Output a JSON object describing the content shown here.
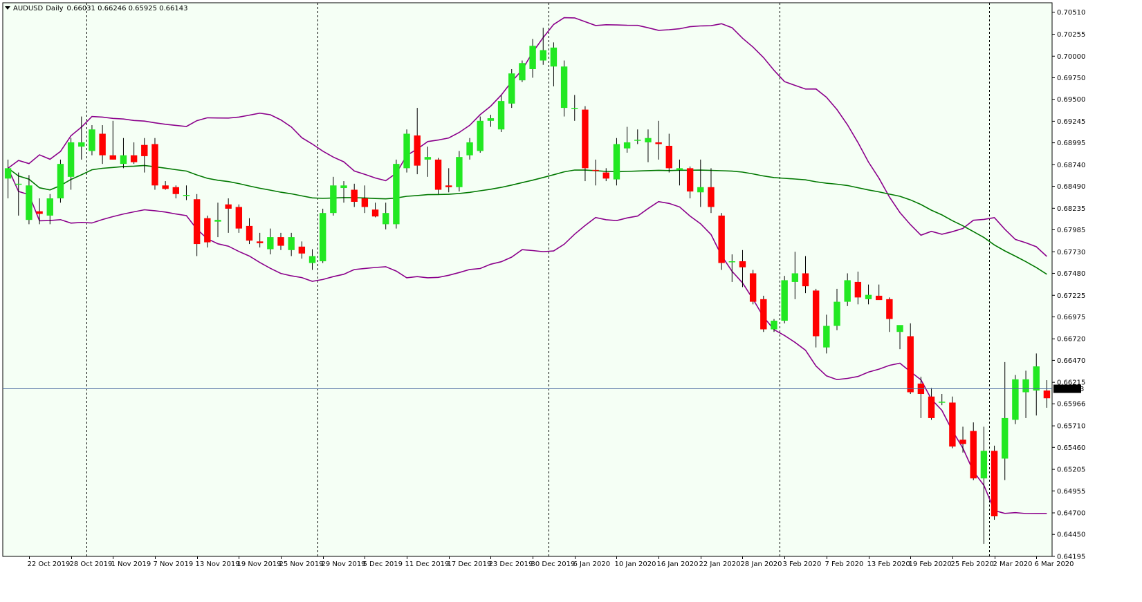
{
  "header": {
    "symbol": "AUDUSD",
    "timeframe": "Daily",
    "ohlc_text": "0.66031 0.66246 0.65925 0.66143"
  },
  "colors": {
    "background": "#f5fff5",
    "bull": "#22e822",
    "bear": "#ff0000",
    "wick": "#000000",
    "bb_line": "#8b008b",
    "ma_line": "#007800",
    "grid_separator": "#000000",
    "price_line": "#4a6aa0",
    "price_box": "#000000",
    "price_box_text": "#ffffff"
  },
  "chart_data": {
    "type": "candlestick",
    "symbol": "AUDUSD",
    "timeframe": "Daily",
    "current_price": 0.66143,
    "y_ticks": [
      0.7051,
      0.70255,
      0.7,
      0.6975,
      0.695,
      0.69245,
      0.68995,
      0.6874,
      0.6849,
      0.68235,
      0.67985,
      0.6773,
      0.6748,
      0.67225,
      0.66975,
      0.6672,
      0.6647,
      0.66215,
      0.65966,
      0.6571,
      0.6546,
      0.65205,
      0.64955,
      0.647,
      0.6445,
      0.64195
    ],
    "ylim": [
      0.64195,
      0.7062
    ],
    "x_tick_labels": [
      {
        "index": 2,
        "label": "22 Oct 2019"
      },
      {
        "index": 6,
        "label": "28 Oct 2019"
      },
      {
        "index": 10,
        "label": "1 Nov 2019"
      },
      {
        "index": 14,
        "label": "7 Nov 2019"
      },
      {
        "index": 18,
        "label": "13 Nov 2019"
      },
      {
        "index": 22,
        "label": "19 Nov 2019"
      },
      {
        "index": 26,
        "label": "25 Nov 2019"
      },
      {
        "index": 30,
        "label": "29 Nov 2019"
      },
      {
        "index": 34,
        "label": "5 Dec 2019"
      },
      {
        "index": 38,
        "label": "11 Dec 2019"
      },
      {
        "index": 42,
        "label": "17 Dec 2019"
      },
      {
        "index": 46,
        "label": "23 Dec 2019"
      },
      {
        "index": 50,
        "label": "30 Dec 2019"
      },
      {
        "index": 54,
        "label": "6 Jan 2020"
      },
      {
        "index": 58,
        "label": "10 Jan 2020"
      },
      {
        "index": 62,
        "label": "16 Jan 2020"
      },
      {
        "index": 66,
        "label": "22 Jan 2020"
      },
      {
        "index": 70,
        "label": "28 Jan 2020"
      },
      {
        "index": 74,
        "label": "3 Feb 2020"
      },
      {
        "index": 78,
        "label": "7 Feb 2020"
      },
      {
        "index": 82,
        "label": "13 Feb 2020"
      },
      {
        "index": 86,
        "label": "19 Feb 2020"
      },
      {
        "index": 90,
        "label": "25 Feb 2020"
      },
      {
        "index": 94,
        "label": "2 Mar 2020"
      },
      {
        "index": 98,
        "label": "6 Mar 2020"
      }
    ],
    "period_separators_at_index": [
      7.5,
      29.5,
      51.5,
      73.5,
      93.5
    ],
    "candles": [
      {
        "o": 0.6858,
        "h": 0.688,
        "l": 0.6835,
        "c": 0.687
      },
      {
        "o": 0.6852,
        "h": 0.6865,
        "l": 0.6815,
        "c": 0.6852
      },
      {
        "o": 0.681,
        "h": 0.6862,
        "l": 0.6805,
        "c": 0.685
      },
      {
        "o": 0.682,
        "h": 0.6835,
        "l": 0.6805,
        "c": 0.6817
      },
      {
        "o": 0.6815,
        "h": 0.684,
        "l": 0.6805,
        "c": 0.6835
      },
      {
        "o": 0.6835,
        "h": 0.688,
        "l": 0.683,
        "c": 0.6875
      },
      {
        "o": 0.686,
        "h": 0.6905,
        "l": 0.6845,
        "c": 0.69
      },
      {
        "o": 0.6895,
        "h": 0.693,
        "l": 0.688,
        "c": 0.69
      },
      {
        "o": 0.689,
        "h": 0.692,
        "l": 0.6885,
        "c": 0.6915
      },
      {
        "o": 0.691,
        "h": 0.692,
        "l": 0.6875,
        "c": 0.6885
      },
      {
        "o": 0.6885,
        "h": 0.6925,
        "l": 0.688,
        "c": 0.688
      },
      {
        "o": 0.6875,
        "h": 0.6905,
        "l": 0.687,
        "c": 0.6885
      },
      {
        "o": 0.6885,
        "h": 0.69,
        "l": 0.6875,
        "c": 0.6877
      },
      {
        "o": 0.6897,
        "h": 0.6905,
        "l": 0.6865,
        "c": 0.6884
      },
      {
        "o": 0.6898,
        "h": 0.6905,
        "l": 0.6845,
        "c": 0.685
      },
      {
        "o": 0.685,
        "h": 0.6855,
        "l": 0.6845,
        "c": 0.6846
      },
      {
        "o": 0.6848,
        "h": 0.685,
        "l": 0.6835,
        "c": 0.684
      },
      {
        "o": 0.6838,
        "h": 0.685,
        "l": 0.6833,
        "c": 0.6839
      },
      {
        "o": 0.6834,
        "h": 0.684,
        "l": 0.6768,
        "c": 0.6782
      },
      {
        "o": 0.6812,
        "h": 0.6815,
        "l": 0.6778,
        "c": 0.6784
      },
      {
        "o": 0.6808,
        "h": 0.683,
        "l": 0.679,
        "c": 0.681
      },
      {
        "o": 0.6828,
        "h": 0.6835,
        "l": 0.6795,
        "c": 0.6823
      },
      {
        "o": 0.6825,
        "h": 0.6828,
        "l": 0.6795,
        "c": 0.68
      },
      {
        "o": 0.6803,
        "h": 0.6812,
        "l": 0.6782,
        "c": 0.6786
      },
      {
        "o": 0.6785,
        "h": 0.6795,
        "l": 0.6778,
        "c": 0.6783
      },
      {
        "o": 0.6776,
        "h": 0.68,
        "l": 0.677,
        "c": 0.679
      },
      {
        "o": 0.679,
        "h": 0.6795,
        "l": 0.6775,
        "c": 0.678
      },
      {
        "o": 0.6775,
        "h": 0.6795,
        "l": 0.6768,
        "c": 0.679
      },
      {
        "o": 0.6779,
        "h": 0.6785,
        "l": 0.6765,
        "c": 0.6771
      },
      {
        "o": 0.676,
        "h": 0.6776,
        "l": 0.6752,
        "c": 0.6768
      },
      {
        "o": 0.6762,
        "h": 0.6823,
        "l": 0.676,
        "c": 0.6818
      },
      {
        "o": 0.6818,
        "h": 0.686,
        "l": 0.6815,
        "c": 0.685
      },
      {
        "o": 0.6847,
        "h": 0.6855,
        "l": 0.683,
        "c": 0.685
      },
      {
        "o": 0.6845,
        "h": 0.6852,
        "l": 0.6825,
        "c": 0.6831
      },
      {
        "o": 0.6835,
        "h": 0.685,
        "l": 0.6818,
        "c": 0.6825
      },
      {
        "o": 0.6822,
        "h": 0.683,
        "l": 0.6813,
        "c": 0.6814
      },
      {
        "o": 0.6805,
        "h": 0.683,
        "l": 0.6799,
        "c": 0.6818
      },
      {
        "o": 0.6805,
        "h": 0.688,
        "l": 0.68,
        "c": 0.6875
      },
      {
        "o": 0.687,
        "h": 0.6915,
        "l": 0.6865,
        "c": 0.691
      },
      {
        "o": 0.6908,
        "h": 0.694,
        "l": 0.6863,
        "c": 0.6873
      },
      {
        "o": 0.688,
        "h": 0.6895,
        "l": 0.686,
        "c": 0.6883
      },
      {
        "o": 0.688,
        "h": 0.6882,
        "l": 0.684,
        "c": 0.6845
      },
      {
        "o": 0.685,
        "h": 0.687,
        "l": 0.6842,
        "c": 0.6848
      },
      {
        "o": 0.6848,
        "h": 0.689,
        "l": 0.6843,
        "c": 0.6883
      },
      {
        "o": 0.6885,
        "h": 0.6905,
        "l": 0.688,
        "c": 0.69
      },
      {
        "o": 0.689,
        "h": 0.693,
        "l": 0.6888,
        "c": 0.6925
      },
      {
        "o": 0.6925,
        "h": 0.6932,
        "l": 0.6918,
        "c": 0.6928
      },
      {
        "o": 0.6915,
        "h": 0.6955,
        "l": 0.6912,
        "c": 0.6948
      },
      {
        "o": 0.6945,
        "h": 0.6985,
        "l": 0.694,
        "c": 0.698
      },
      {
        "o": 0.6972,
        "h": 0.6995,
        "l": 0.697,
        "c": 0.6992
      },
      {
        "o": 0.6985,
        "h": 0.702,
        "l": 0.6975,
        "c": 0.7012
      },
      {
        "o": 0.6995,
        "h": 0.7033,
        "l": 0.699,
        "c": 0.7007
      },
      {
        "o": 0.6988,
        "h": 0.7016,
        "l": 0.6965,
        "c": 0.701
      },
      {
        "o": 0.694,
        "h": 0.6995,
        "l": 0.693,
        "c": 0.6988
      },
      {
        "o": 0.694,
        "h": 0.6955,
        "l": 0.6925,
        "c": 0.694
      },
      {
        "o": 0.6938,
        "h": 0.6942,
        "l": 0.6855,
        "c": 0.687
      },
      {
        "o": 0.6868,
        "h": 0.688,
        "l": 0.685,
        "c": 0.6867
      },
      {
        "o": 0.6865,
        "h": 0.687,
        "l": 0.6855,
        "c": 0.6858
      },
      {
        "o": 0.6857,
        "h": 0.6905,
        "l": 0.685,
        "c": 0.6898
      },
      {
        "o": 0.6893,
        "h": 0.6918,
        "l": 0.6888,
        "c": 0.69
      },
      {
        "o": 0.6902,
        "h": 0.6915,
        "l": 0.6898,
        "c": 0.6903
      },
      {
        "o": 0.69,
        "h": 0.6915,
        "l": 0.6877,
        "c": 0.6905
      },
      {
        "o": 0.69,
        "h": 0.6925,
        "l": 0.688,
        "c": 0.6898
      },
      {
        "o": 0.6896,
        "h": 0.691,
        "l": 0.6865,
        "c": 0.687
      },
      {
        "o": 0.6868,
        "h": 0.688,
        "l": 0.685,
        "c": 0.687
      },
      {
        "o": 0.687,
        "h": 0.6872,
        "l": 0.6835,
        "c": 0.6843
      },
      {
        "o": 0.6842,
        "h": 0.688,
        "l": 0.6825,
        "c": 0.6848
      },
      {
        "o": 0.6848,
        "h": 0.687,
        "l": 0.6818,
        "c": 0.6825
      },
      {
        "o": 0.6815,
        "h": 0.6818,
        "l": 0.6752,
        "c": 0.676
      },
      {
        "o": 0.6762,
        "h": 0.677,
        "l": 0.6738,
        "c": 0.6762
      },
      {
        "o": 0.6762,
        "h": 0.6775,
        "l": 0.6732,
        "c": 0.6755
      },
      {
        "o": 0.6748,
        "h": 0.6752,
        "l": 0.6712,
        "c": 0.6715
      },
      {
        "o": 0.6718,
        "h": 0.6722,
        "l": 0.668,
        "c": 0.6683
      },
      {
        "o": 0.6683,
        "h": 0.6695,
        "l": 0.668,
        "c": 0.6693
      },
      {
        "o": 0.6693,
        "h": 0.6745,
        "l": 0.669,
        "c": 0.674
      },
      {
        "o": 0.6738,
        "h": 0.6773,
        "l": 0.6718,
        "c": 0.6748
      },
      {
        "o": 0.6748,
        "h": 0.6768,
        "l": 0.6725,
        "c": 0.6733
      },
      {
        "o": 0.6728,
        "h": 0.673,
        "l": 0.6662,
        "c": 0.6675
      },
      {
        "o": 0.6662,
        "h": 0.67,
        "l": 0.6655,
        "c": 0.6687
      },
      {
        "o": 0.6687,
        "h": 0.673,
        "l": 0.6682,
        "c": 0.6715
      },
      {
        "o": 0.6715,
        "h": 0.6748,
        "l": 0.671,
        "c": 0.674
      },
      {
        "o": 0.6738,
        "h": 0.675,
        "l": 0.6712,
        "c": 0.672
      },
      {
        "o": 0.6718,
        "h": 0.6735,
        "l": 0.6712,
        "c": 0.6723
      },
      {
        "o": 0.6722,
        "h": 0.6735,
        "l": 0.6718,
        "c": 0.6717
      },
      {
        "o": 0.6718,
        "h": 0.672,
        "l": 0.668,
        "c": 0.6695
      },
      {
        "o": 0.668,
        "h": 0.6685,
        "l": 0.666,
        "c": 0.6688
      },
      {
        "o": 0.6675,
        "h": 0.669,
        "l": 0.6608,
        "c": 0.661
      },
      {
        "o": 0.662,
        "h": 0.6628,
        "l": 0.658,
        "c": 0.6608
      },
      {
        "o": 0.6605,
        "h": 0.6615,
        "l": 0.6578,
        "c": 0.658
      },
      {
        "o": 0.6598,
        "h": 0.6608,
        "l": 0.6595,
        "c": 0.6599
      },
      {
        "o": 0.6598,
        "h": 0.6605,
        "l": 0.6545,
        "c": 0.6547
      },
      {
        "o": 0.6555,
        "h": 0.657,
        "l": 0.654,
        "c": 0.655
      },
      {
        "o": 0.6565,
        "h": 0.6575,
        "l": 0.6508,
        "c": 0.651
      },
      {
        "o": 0.651,
        "h": 0.657,
        "l": 0.6434,
        "c": 0.6542
      },
      {
        "o": 0.6542,
        "h": 0.6548,
        "l": 0.6462,
        "c": 0.6466
      },
      {
        "o": 0.6533,
        "h": 0.6645,
        "l": 0.6508,
        "c": 0.658
      },
      {
        "o": 0.6578,
        "h": 0.663,
        "l": 0.6573,
        "c": 0.6625
      },
      {
        "o": 0.661,
        "h": 0.6635,
        "l": 0.658,
        "c": 0.6625
      },
      {
        "o": 0.6612,
        "h": 0.6655,
        "l": 0.6583,
        "c": 0.664
      },
      {
        "o": 0.6612,
        "h": 0.6624,
        "l": 0.6592,
        "c": 0.6603
      }
    ],
    "bb_period": 20,
    "ma_period": 50
  }
}
